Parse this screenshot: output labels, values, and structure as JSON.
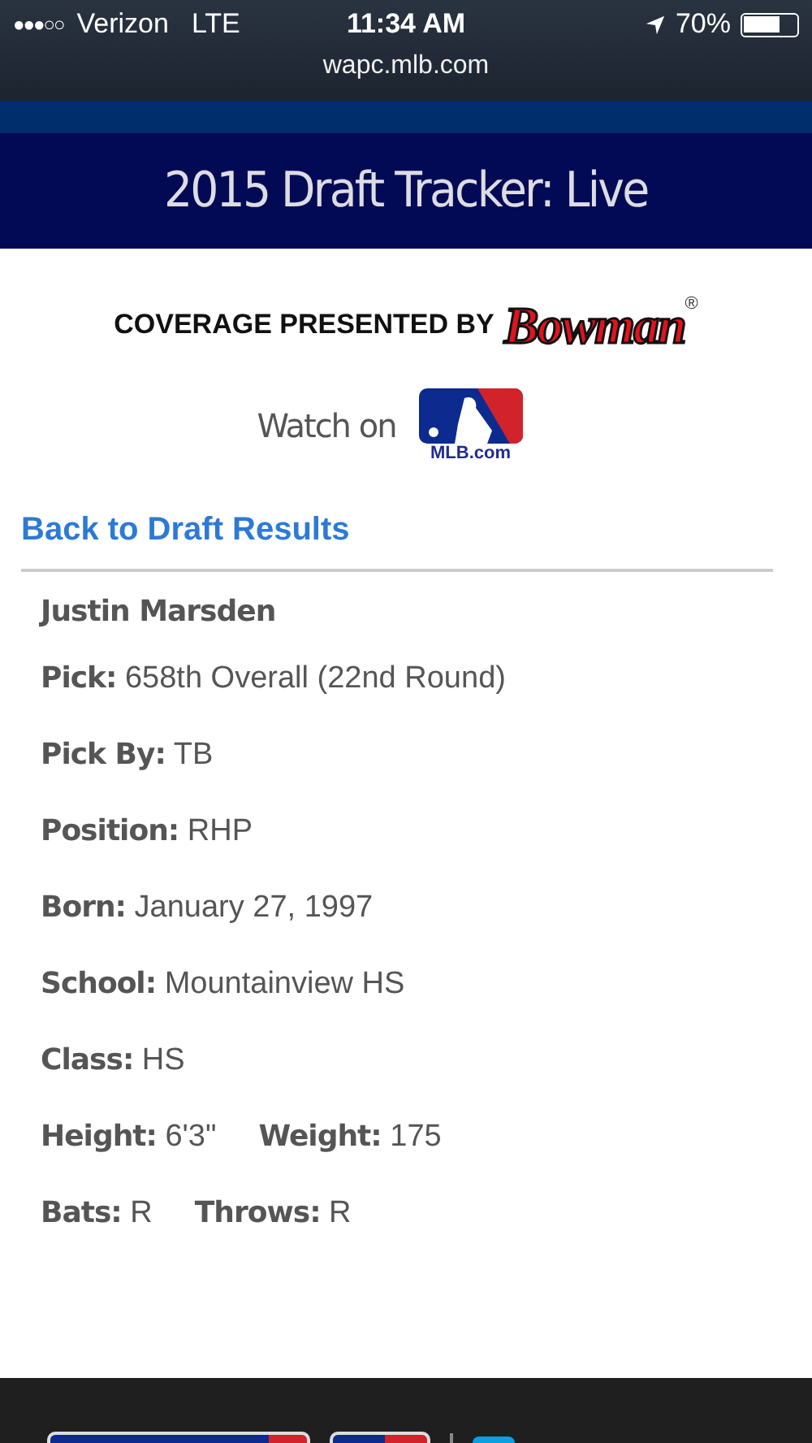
{
  "status_bar": {
    "signal": "●●●○○",
    "carrier": "Verizon",
    "network": "LTE",
    "time": "11:34 AM",
    "battery": "70%"
  },
  "address_bar": {
    "url": "wapc.mlb.com"
  },
  "header": {
    "title": "2015 Draft Tracker: Live"
  },
  "sponsor": {
    "text": "COVERAGE PRESENTED BY",
    "brand": "Bowman",
    "mark": "®"
  },
  "watch": {
    "text": "Watch on",
    "logo_caption": "MLB.com"
  },
  "back_link": "Back to Draft Results",
  "player": {
    "name": "Justin Marsden",
    "rows": [
      [
        {
          "label": "Pick:",
          "value": "658th Overall (22nd Round)"
        }
      ],
      [
        {
          "label": "Pick By:",
          "value": "TB"
        }
      ],
      [
        {
          "label": "Position:",
          "value": "RHP"
        }
      ],
      [
        {
          "label": "Born:",
          "value": "January 27, 1997"
        }
      ],
      [
        {
          "label": "School:",
          "value": "Mountainview HS"
        }
      ],
      [
        {
          "label": "Class:",
          "value": "HS"
        }
      ],
      [
        {
          "label": "Height:",
          "value": "6'3\""
        },
        {
          "label": "Weight:",
          "value": "175"
        }
      ],
      [
        {
          "label": "Bats:",
          "value": "R"
        },
        {
          "label": "Throws:",
          "value": "R"
        }
      ]
    ]
  }
}
